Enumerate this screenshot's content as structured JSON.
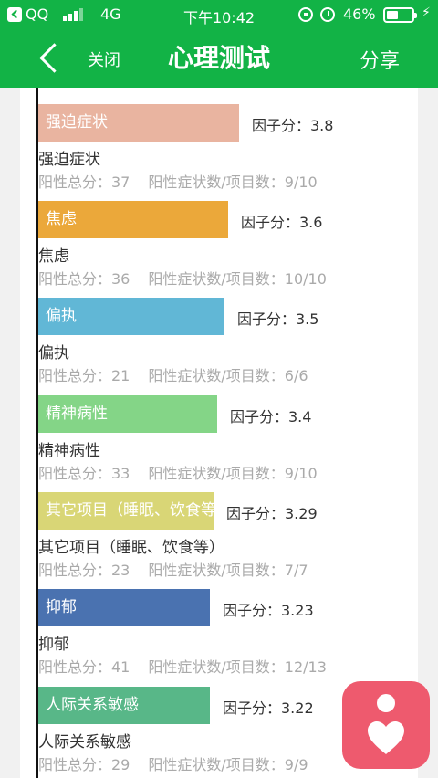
{
  "status": {
    "carrier": "QQ",
    "network": "4G",
    "time": "下午10:42",
    "battery_percent": "46%",
    "battery_level": 0.46
  },
  "nav": {
    "close_label": "关闭",
    "title": "心理测试",
    "share_label": "分享"
  },
  "results": [
    {
      "bar_label": "强迫症状",
      "factor": "因子分：3.8",
      "name": "强迫症状",
      "total": "阳性总分：37",
      "ratio": "阳性症状数/项目数：9/10",
      "color": "#e9b4a0",
      "score": 3.8
    },
    {
      "bar_label": "焦虑",
      "factor": "因子分：3.6",
      "name": "焦虑",
      "total": "阳性总分：36",
      "ratio": "阳性症状数/项目数：10/10",
      "color": "#eba83a",
      "score": 3.6
    },
    {
      "bar_label": "偏执",
      "factor": "因子分：3.5",
      "name": "偏执",
      "total": "阳性总分：21",
      "ratio": "阳性症状数/项目数：6/6",
      "color": "#61b7d6",
      "score": 3.5
    },
    {
      "bar_label": "精神病性",
      "factor": "因子分：3.4",
      "name": "精神病性",
      "total": "阳性总分：33",
      "ratio": "阳性症状数/项目数：9/10",
      "color": "#84d587",
      "score": 3.4
    },
    {
      "bar_label": "其它项目（睡眠、饮食等）",
      "factor": "因子分：3.29",
      "name": "其它项目（睡眠、饮食等）",
      "total": "阳性总分：23",
      "ratio": "阳性症状数/项目数：7/7",
      "color": "#d9d676",
      "score": 3.29
    },
    {
      "bar_label": "抑郁",
      "factor": "因子分：3.23",
      "name": "抑郁",
      "total": "阳性总分：41",
      "ratio": "阳性症状数/项目数：12/13",
      "color": "#4a72b0",
      "score": 3.23
    },
    {
      "bar_label": "人际关系敏感",
      "factor": "因子分：3.22",
      "name": "人际关系敏感",
      "total": "阳性总分：29",
      "ratio": "阳性症状数/项目数：9/9",
      "color": "#58b788",
      "score": 3.22
    }
  ],
  "fab": {
    "icon": "heart-person-icon",
    "color": "#ee5a6e"
  }
}
